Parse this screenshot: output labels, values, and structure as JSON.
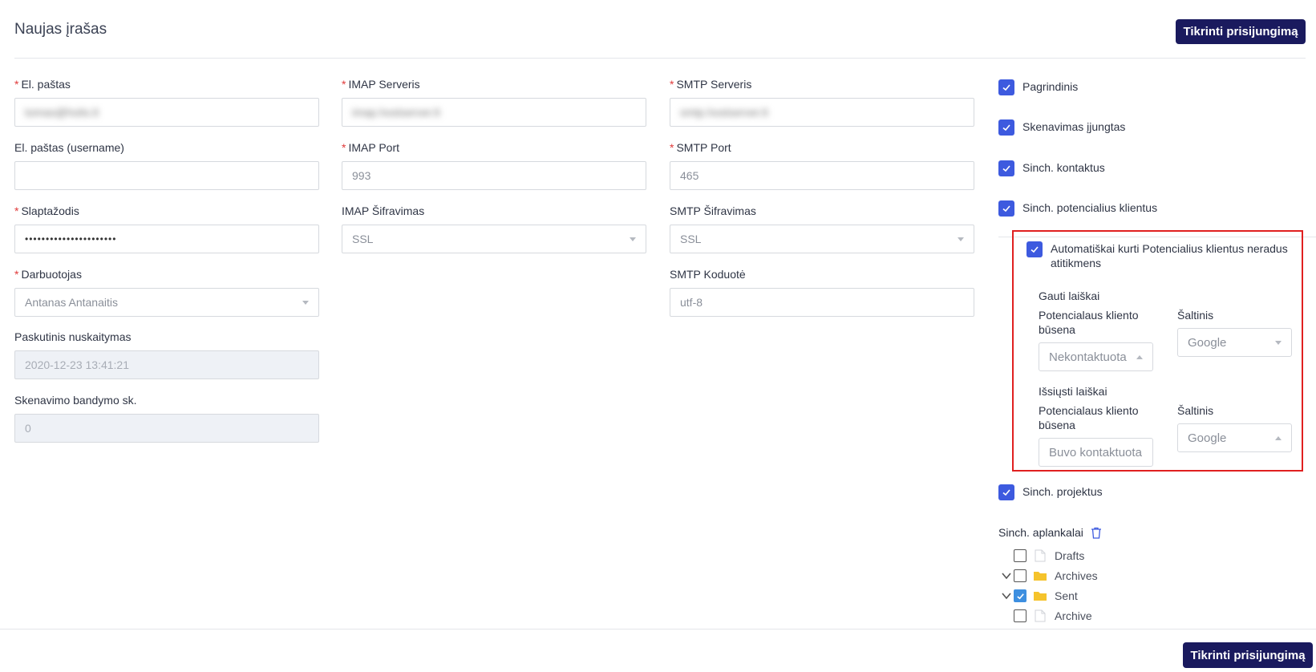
{
  "header": {
    "title": "Naujas įrašas",
    "check_button": "Tikrinti prisijungimą"
  },
  "footer": {
    "check_button": "Tikrinti prisijungimą"
  },
  "form": {
    "email": {
      "label": "El. paštas",
      "value": "tomas@holis.lt"
    },
    "username": {
      "label": "El. paštas (username)",
      "value": ""
    },
    "password": {
      "label": "Slaptažodis",
      "value": "••••••••••••••••••••••"
    },
    "employee": {
      "label": "Darbuotojas",
      "value": "Antanas Antanaitis"
    },
    "last_read": {
      "label": "Paskutinis nuskaitymas",
      "value": "2020-12-23 13:41:21"
    },
    "scan_attempts": {
      "label": "Skenavimo bandymo sk.",
      "value": "0"
    },
    "imap_server": {
      "label": "IMAP Serveris",
      "value": "imap.hostserver.lt"
    },
    "imap_port": {
      "label": "IMAP Port",
      "value": "993"
    },
    "imap_encryption": {
      "label": "IMAP Šifravimas",
      "value": "SSL"
    },
    "smtp_server": {
      "label": "SMTP Serveris",
      "value": "smtp.hostserver.lt"
    },
    "smtp_port": {
      "label": "SMTP Port",
      "value": "465"
    },
    "smtp_encryption": {
      "label": "SMTP Šifravimas",
      "value": "SSL"
    },
    "smtp_encoding": {
      "label": "SMTP Koduotė",
      "value": "utf-8"
    }
  },
  "options": {
    "main": "Pagrindinis",
    "scan_enabled": "Skenavimas įjungtas",
    "sync_contacts": "Sinch. kontaktus",
    "sync_leads": "Sinch. potencialius klientus",
    "auto_create": "Automatiškai kurti Potencialius klientus neradus atitikmens",
    "sync_projects": "Sinch. projektus"
  },
  "leads": {
    "received": {
      "title": "Gauti laiškai",
      "status_label": "Potencialaus kliento būsena",
      "status_value": "Nekontaktuota",
      "source_label": "Šaltinis",
      "source_value": "Google"
    },
    "sent": {
      "title": "Išsiųsti laiškai",
      "status_label": "Potencialaus kliento būsena",
      "status_value": "Buvo kontaktuota",
      "source_label": "Šaltinis",
      "source_value": "Google"
    }
  },
  "folders": {
    "title": "Sinch. aplankalai",
    "items": [
      {
        "name": "Drafts",
        "checked": false,
        "expandable": false,
        "icon": "file-icon"
      },
      {
        "name": "Archives",
        "checked": false,
        "expandable": true,
        "icon": "folder-icon"
      },
      {
        "name": "Sent",
        "checked": true,
        "expandable": true,
        "icon": "folder-icon"
      },
      {
        "name": "Archive",
        "checked": false,
        "expandable": false,
        "icon": "file-icon"
      }
    ]
  },
  "colors": {
    "primary_button": "#1a1a5e",
    "checkbox": "#3d5adf",
    "highlight_border": "#e02020",
    "folder": "#f5c32c"
  }
}
